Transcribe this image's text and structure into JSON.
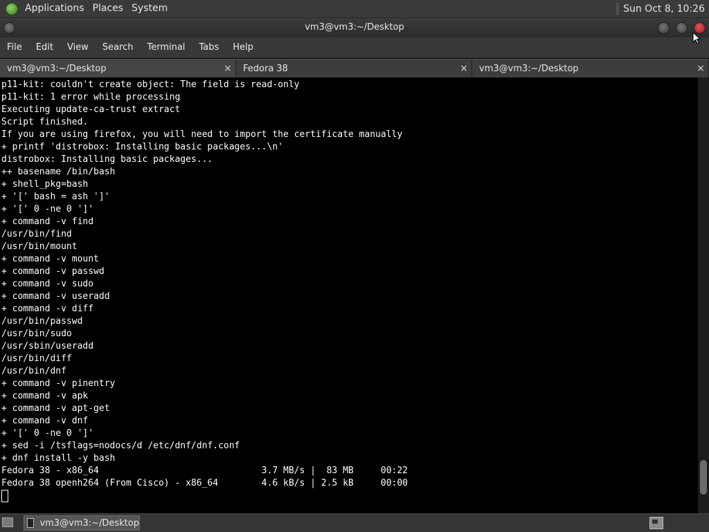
{
  "top_panel": {
    "menus": [
      "Applications",
      "Places",
      "System"
    ],
    "clock": "Sun Oct  8, 10:26"
  },
  "window": {
    "title": "vm3@vm3:~/Desktop"
  },
  "menubar": {
    "items": [
      "File",
      "Edit",
      "View",
      "Search",
      "Terminal",
      "Tabs",
      "Help"
    ]
  },
  "tabs": [
    {
      "label": "vm3@vm3:~/Desktop",
      "close": "×",
      "active": true
    },
    {
      "label": "Fedora 38",
      "close": "×",
      "active": false
    },
    {
      "label": "vm3@vm3:~/Desktop",
      "close": "×",
      "active": false
    }
  ],
  "terminal": {
    "lines": [
      "p11-kit: couldn't create object: The field is read-only",
      "p11-kit: 1 error while processing",
      "Executing update-ca-trust extract",
      "Script finished.",
      "If you are using firefox, you will need to import the certificate manually",
      "+ printf 'distrobox: Installing basic packages...\\n'",
      "distrobox: Installing basic packages...",
      "++ basename /bin/bash",
      "+ shell_pkg=bash",
      "+ '[' bash = ash ']'",
      "+ '[' 0 -ne 0 ']'",
      "+ command -v find",
      "/usr/bin/find",
      "/usr/bin/mount",
      "+ command -v mount",
      "+ command -v passwd",
      "+ command -v sudo",
      "+ command -v useradd",
      "+ command -v diff",
      "/usr/bin/passwd",
      "/usr/bin/sudo",
      "/usr/sbin/useradd",
      "/usr/bin/diff",
      "/usr/bin/dnf",
      "+ command -v pinentry",
      "+ command -v apk",
      "+ command -v apt-get",
      "+ command -v dnf",
      "+ '[' 0 -ne 0 ']'",
      "+ sed -i /tsflags=nodocs/d /etc/dnf/dnf.conf",
      "+ dnf install -y bash",
      "Fedora 38 - x86_64                              3.7 MB/s |  83 MB     00:22",
      "Fedora 38 openh264 (From Cisco) - x86_64        4.6 kB/s | 2.5 kB     00:00"
    ],
    "scroll_position": 0.96
  },
  "bottom_panel": {
    "task_label": "vm3@vm3:~/Desktop"
  },
  "icons": {
    "apps": "applications-icon",
    "close": "close-icon",
    "terminal": "terminal-icon",
    "workspace": "workspace-switcher-icon",
    "pointer": "mouse-pointer-icon"
  }
}
